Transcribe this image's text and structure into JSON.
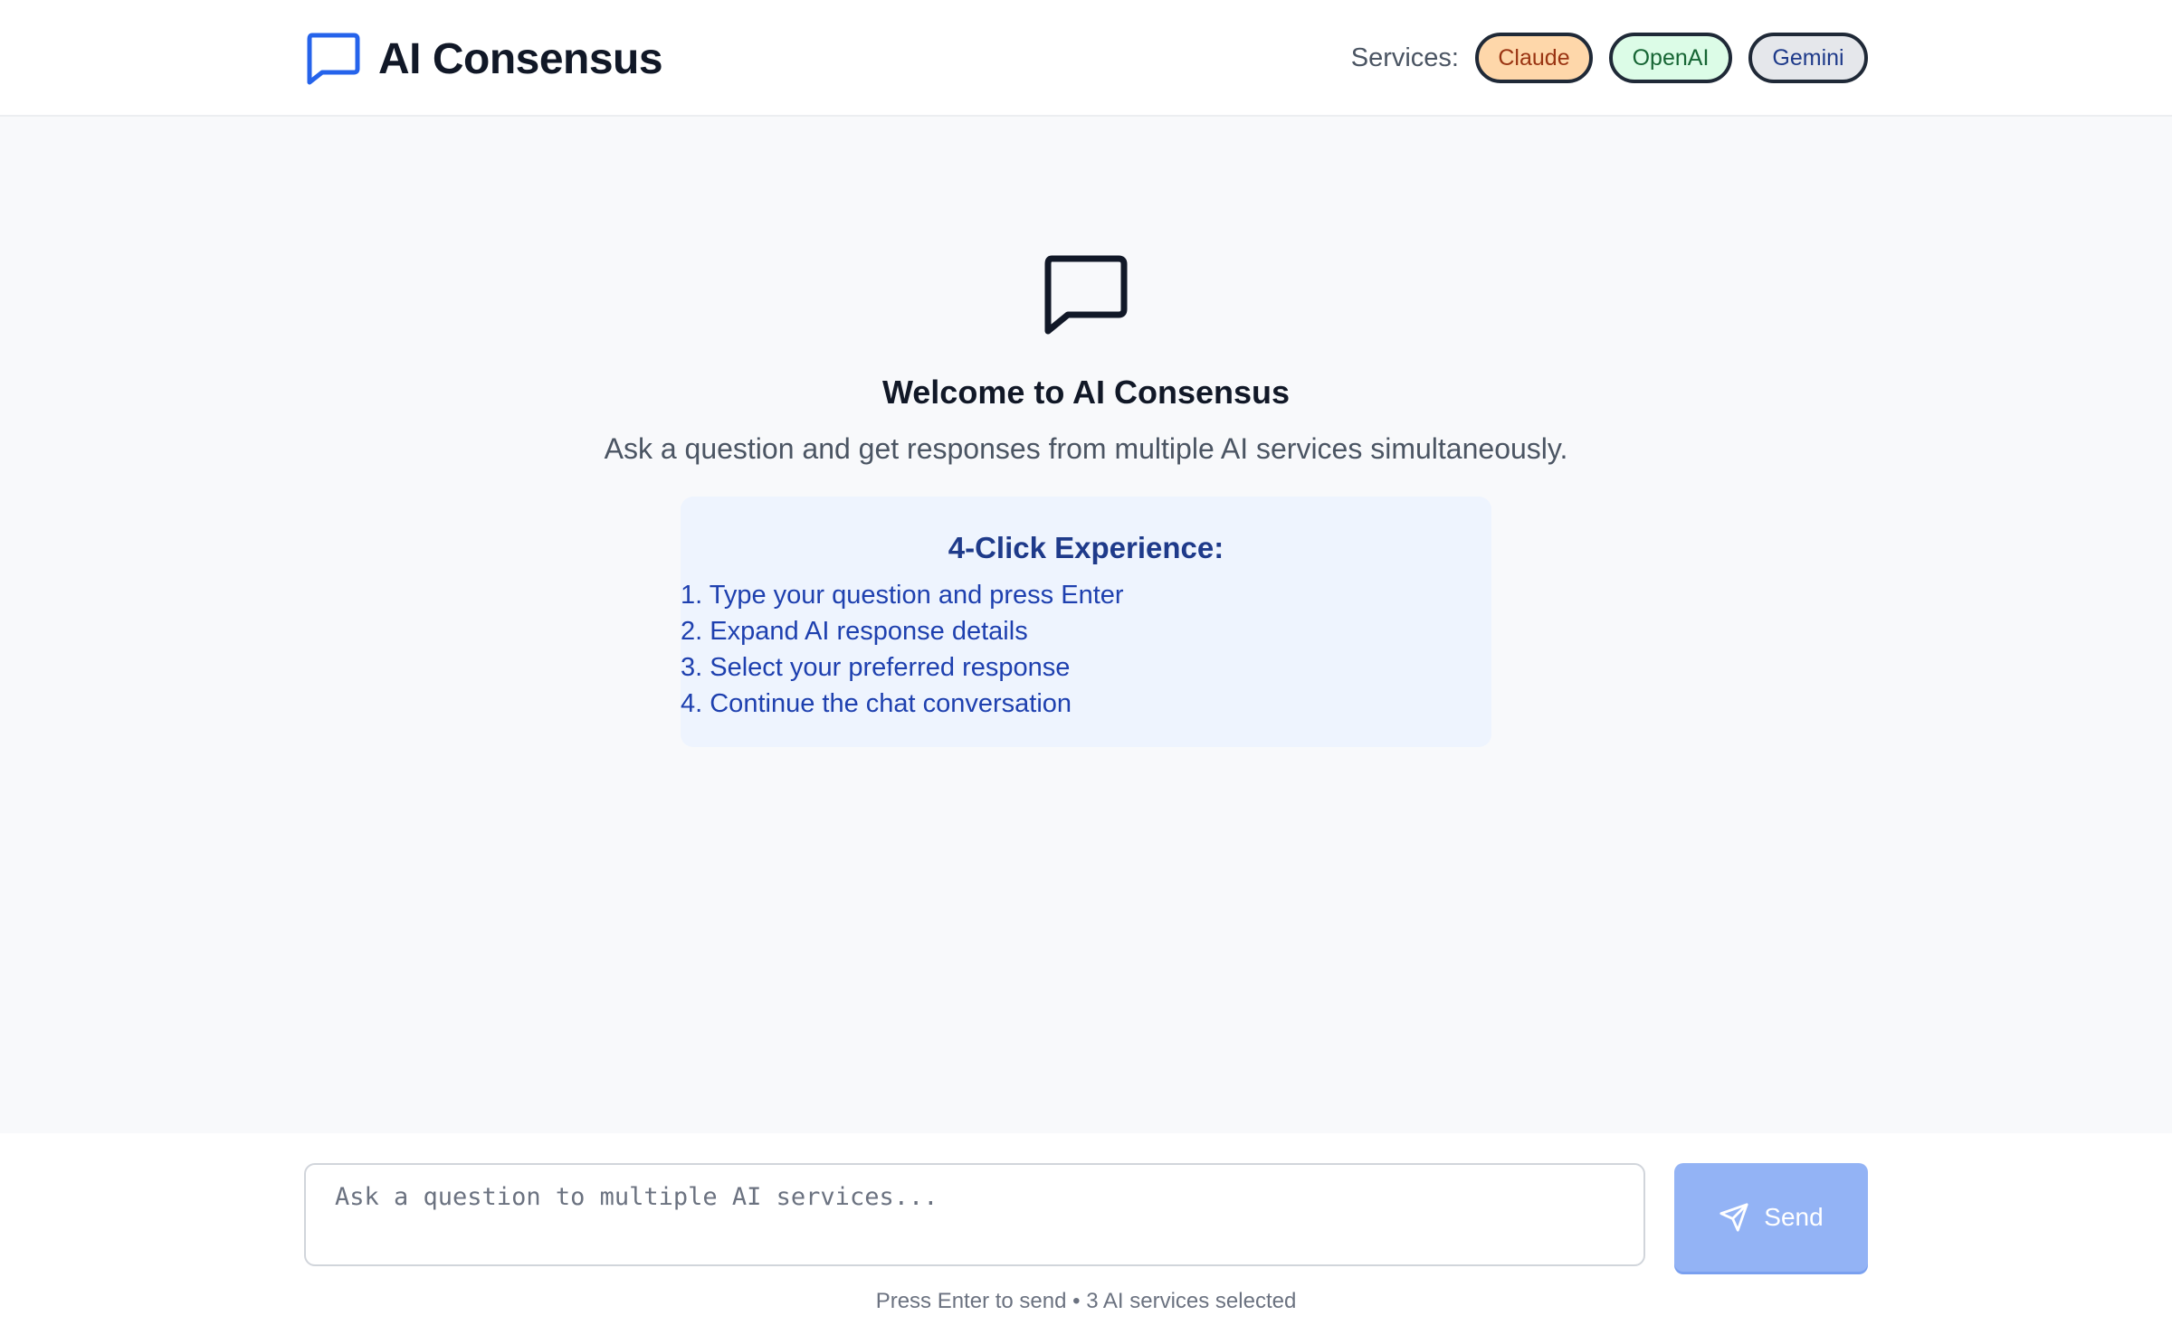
{
  "header": {
    "brand_icon": "chat-bubble-icon",
    "title": "AI Consensus",
    "services_label": "Services:",
    "services": [
      {
        "label": "Claude",
        "color": "#fed7aa"
      },
      {
        "label": "OpenAI",
        "color": "#dcfce7"
      },
      {
        "label": "Gemini",
        "color": "#e5e7eb"
      }
    ]
  },
  "welcome": {
    "icon": "chat-bubble-icon",
    "title": "Welcome to AI Consensus",
    "subtitle": "Ask a question and get responses from multiple AI services simultaneously.",
    "steps_title": "4-Click Experience:",
    "steps": [
      "1. Type your question and press Enter",
      "2. Expand AI response details",
      "3. Select your preferred response",
      "4. Continue the chat conversation"
    ]
  },
  "composer": {
    "placeholder": "Ask a question to multiple AI services...",
    "value": "",
    "send_icon": "send-icon",
    "send_label": "Send",
    "hint": "Press Enter to send • 3 AI services selected"
  },
  "colors": {
    "accent": "#2563eb",
    "send_button": "#93b3f5",
    "steps_background": "#eef4fe"
  }
}
